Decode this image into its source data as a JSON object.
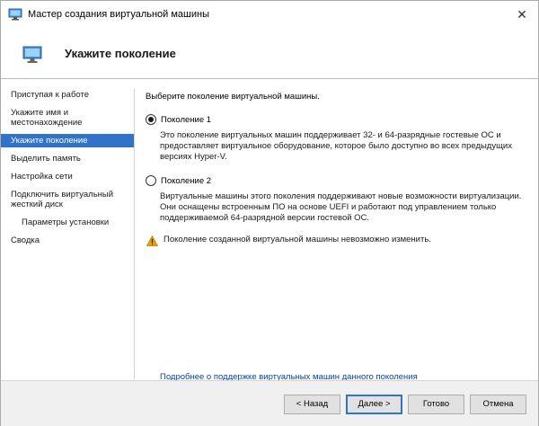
{
  "window": {
    "title": "Мастер создания виртуальной машины",
    "close_glyph": "✕"
  },
  "header": {
    "title": "Укажите поколение"
  },
  "sidebar": {
    "items": [
      {
        "label": "Приступая к работе"
      },
      {
        "label": "Укажите имя и местонахождение"
      },
      {
        "label": "Укажите поколение",
        "active": true
      },
      {
        "label": "Выделить память"
      },
      {
        "label": "Настройка сети"
      },
      {
        "label": "Подключить виртуальный жесткий диск"
      },
      {
        "label": "Параметры установки"
      },
      {
        "label": "Сводка"
      }
    ]
  },
  "main": {
    "prompt": "Выберите поколение виртуальной машины.",
    "options": [
      {
        "label": "Поколение 1",
        "checked": true,
        "description": "Это поколение виртуальных машин поддерживает 32- и 64-разрядные гостевые ОС и предоставляет виртуальное оборудование, которое было доступно во всех предыдущих версиях Hyper-V."
      },
      {
        "label": "Поколение 2",
        "checked": false,
        "description": "Виртуальные машины этого поколения поддерживают новые возможности виртуализации. Они оснащены встроенным ПО на основе UEFI и работают под управлением только поддерживаемой 64-разрядной версии гостевой ОС."
      }
    ],
    "warning": "Поколение созданной виртуальной машины невозможно изменить.",
    "link": "Подробнее о поддержке виртуальных машин данного поколения"
  },
  "footer": {
    "back": "< Назад",
    "next": "Далее >",
    "finish": "Готово",
    "cancel": "Отмена"
  },
  "colors": {
    "accent": "#3173c9",
    "link": "#0645ad",
    "warning": "#e8a300"
  },
  "icons": {
    "title": "monitor-icon",
    "header": "monitor-icon",
    "warning": "warning-icon"
  }
}
